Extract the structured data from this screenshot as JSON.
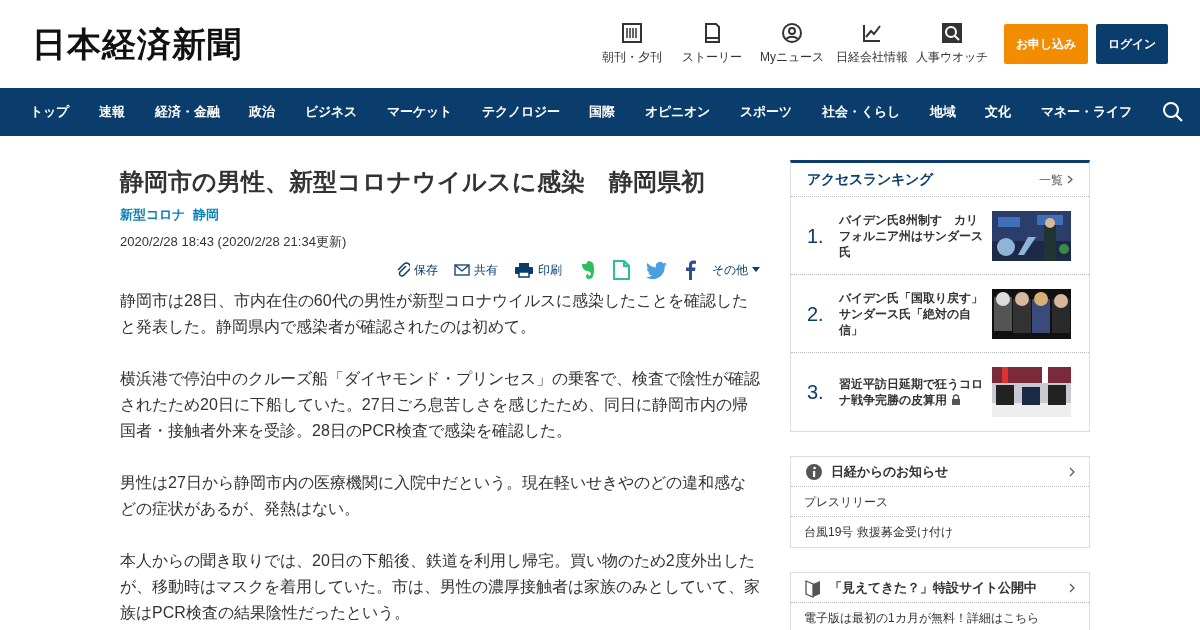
{
  "header": {
    "logo": "日本経済新聞",
    "tools": [
      {
        "kind": "paper",
        "label": "朝刊・夕刊"
      },
      {
        "kind": "story",
        "label": "ストーリー"
      },
      {
        "kind": "person",
        "label": "Myニュース"
      },
      {
        "kind": "chart",
        "label": "日経会社情報"
      },
      {
        "kind": "search",
        "label": "人事ウオッチ"
      }
    ],
    "subscribe": "お申し込み",
    "login": "ログイン"
  },
  "nav": {
    "items": [
      "トップ",
      "速報",
      "経済・金融",
      "政治",
      "ビジネス",
      "マーケット",
      "テクノロジー",
      "国際",
      "オピニオン",
      "スポーツ",
      "社会・くらし",
      "地域",
      "文化",
      "マネー・ライフ"
    ]
  },
  "article": {
    "title": "静岡市の男性、新型コロナウイルスに感染　静岡県初",
    "topics": [
      "新型コロナ",
      "静岡"
    ],
    "date": "2020/2/28 18:43 (2020/2/28 21:34更新)",
    "share": [
      {
        "kind": "clip",
        "label": "保存"
      },
      {
        "kind": "mail",
        "label": "共有"
      },
      {
        "kind": "print",
        "label": "印刷"
      },
      {
        "kind": "evernote"
      },
      {
        "kind": "memo"
      },
      {
        "kind": "twitter"
      },
      {
        "kind": "facebook"
      },
      {
        "kind": "more",
        "label": "その他"
      }
    ],
    "paragraphs": [
      "静岡市は28日、市内在住の60代の男性が新型コロナウイルスに感染したことを確認したと発表した。静岡県内で感染者が確認されたのは初めて。",
      "横浜港で停泊中のクルーズ船「ダイヤモンド・プリンセス」の乗客で、検査で陰性が確認されたため20日に下船していた。27日ごろ息苦しさを感じたため、同日に静岡市内の帰国者・接触者外来を受診。28日のPCR検査で感染を確認した。",
      "男性は27日から静岡市内の医療機関に入院中だという。現在軽いせきやのどの違和感などの症状があるが、発熱はない。",
      "本人からの聞き取りでは、20日の下船後、鉄道を利用し帰宅。買い物のため2度外出したが、移動時はマスクを着用していた。市は、男性の濃厚接触者は家族のみとしていて、家族はPCR検査の結果陰性だったという。"
    ]
  },
  "ranking": {
    "title": "アクセスランキング",
    "more": "一覧",
    "items": [
      {
        "rank": "1.",
        "title": "バイデン氏8州制す　カリフォルニア州はサンダース氏",
        "locked": false
      },
      {
        "rank": "2.",
        "title": "バイデン氏「国取り戻す」サンダース氏「絶対の自信」",
        "locked": false
      },
      {
        "rank": "3.",
        "title": "習近平訪日延期で狂うコロナ戦争完勝の皮算用",
        "locked": true
      }
    ]
  },
  "notices": [
    {
      "kind": "info",
      "title": "日経からのお知らせ",
      "items": [
        "プレスリリース",
        "台風19号 救援募金受け付け"
      ]
    },
    {
      "kind": "leaf",
      "title": "「見えてきた？」特設サイト公開中",
      "items": [
        "電子版は最初の1カ月が無料！詳細はこちら"
      ]
    }
  ]
}
